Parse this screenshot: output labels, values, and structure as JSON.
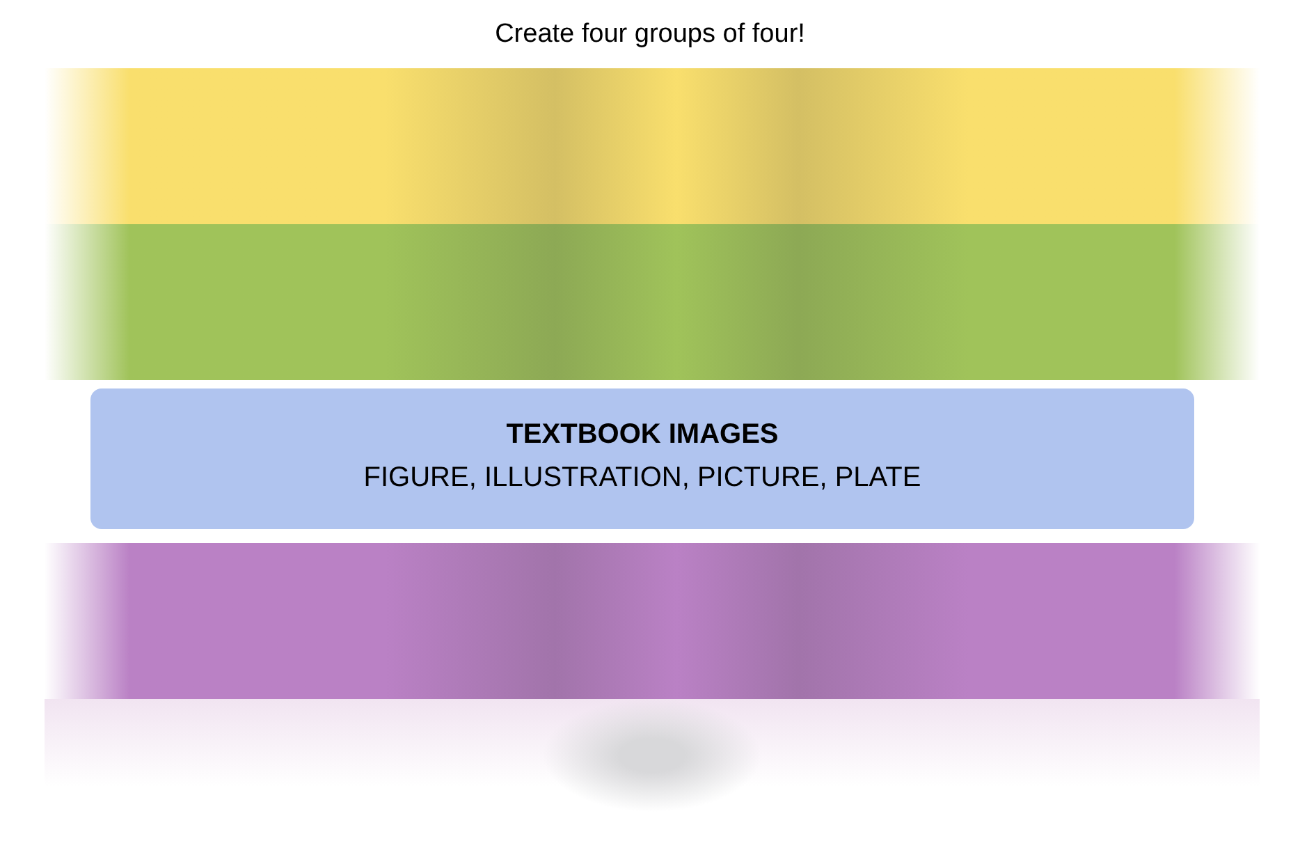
{
  "instructions": "Create four groups of four!",
  "rows": [
    {
      "kind": "obscured",
      "color": "#f9df6d"
    },
    {
      "kind": "obscured",
      "color": "#a0c35a"
    },
    {
      "kind": "solved",
      "color": "#b0c4ef",
      "title": "TEXTBOOK IMAGES",
      "members": "FIGURE, ILLUSTRATION, PICTURE, PLATE"
    },
    {
      "kind": "obscured",
      "color": "#ba81c5"
    },
    {
      "kind": "faded",
      "color": "#d8d8da"
    }
  ]
}
